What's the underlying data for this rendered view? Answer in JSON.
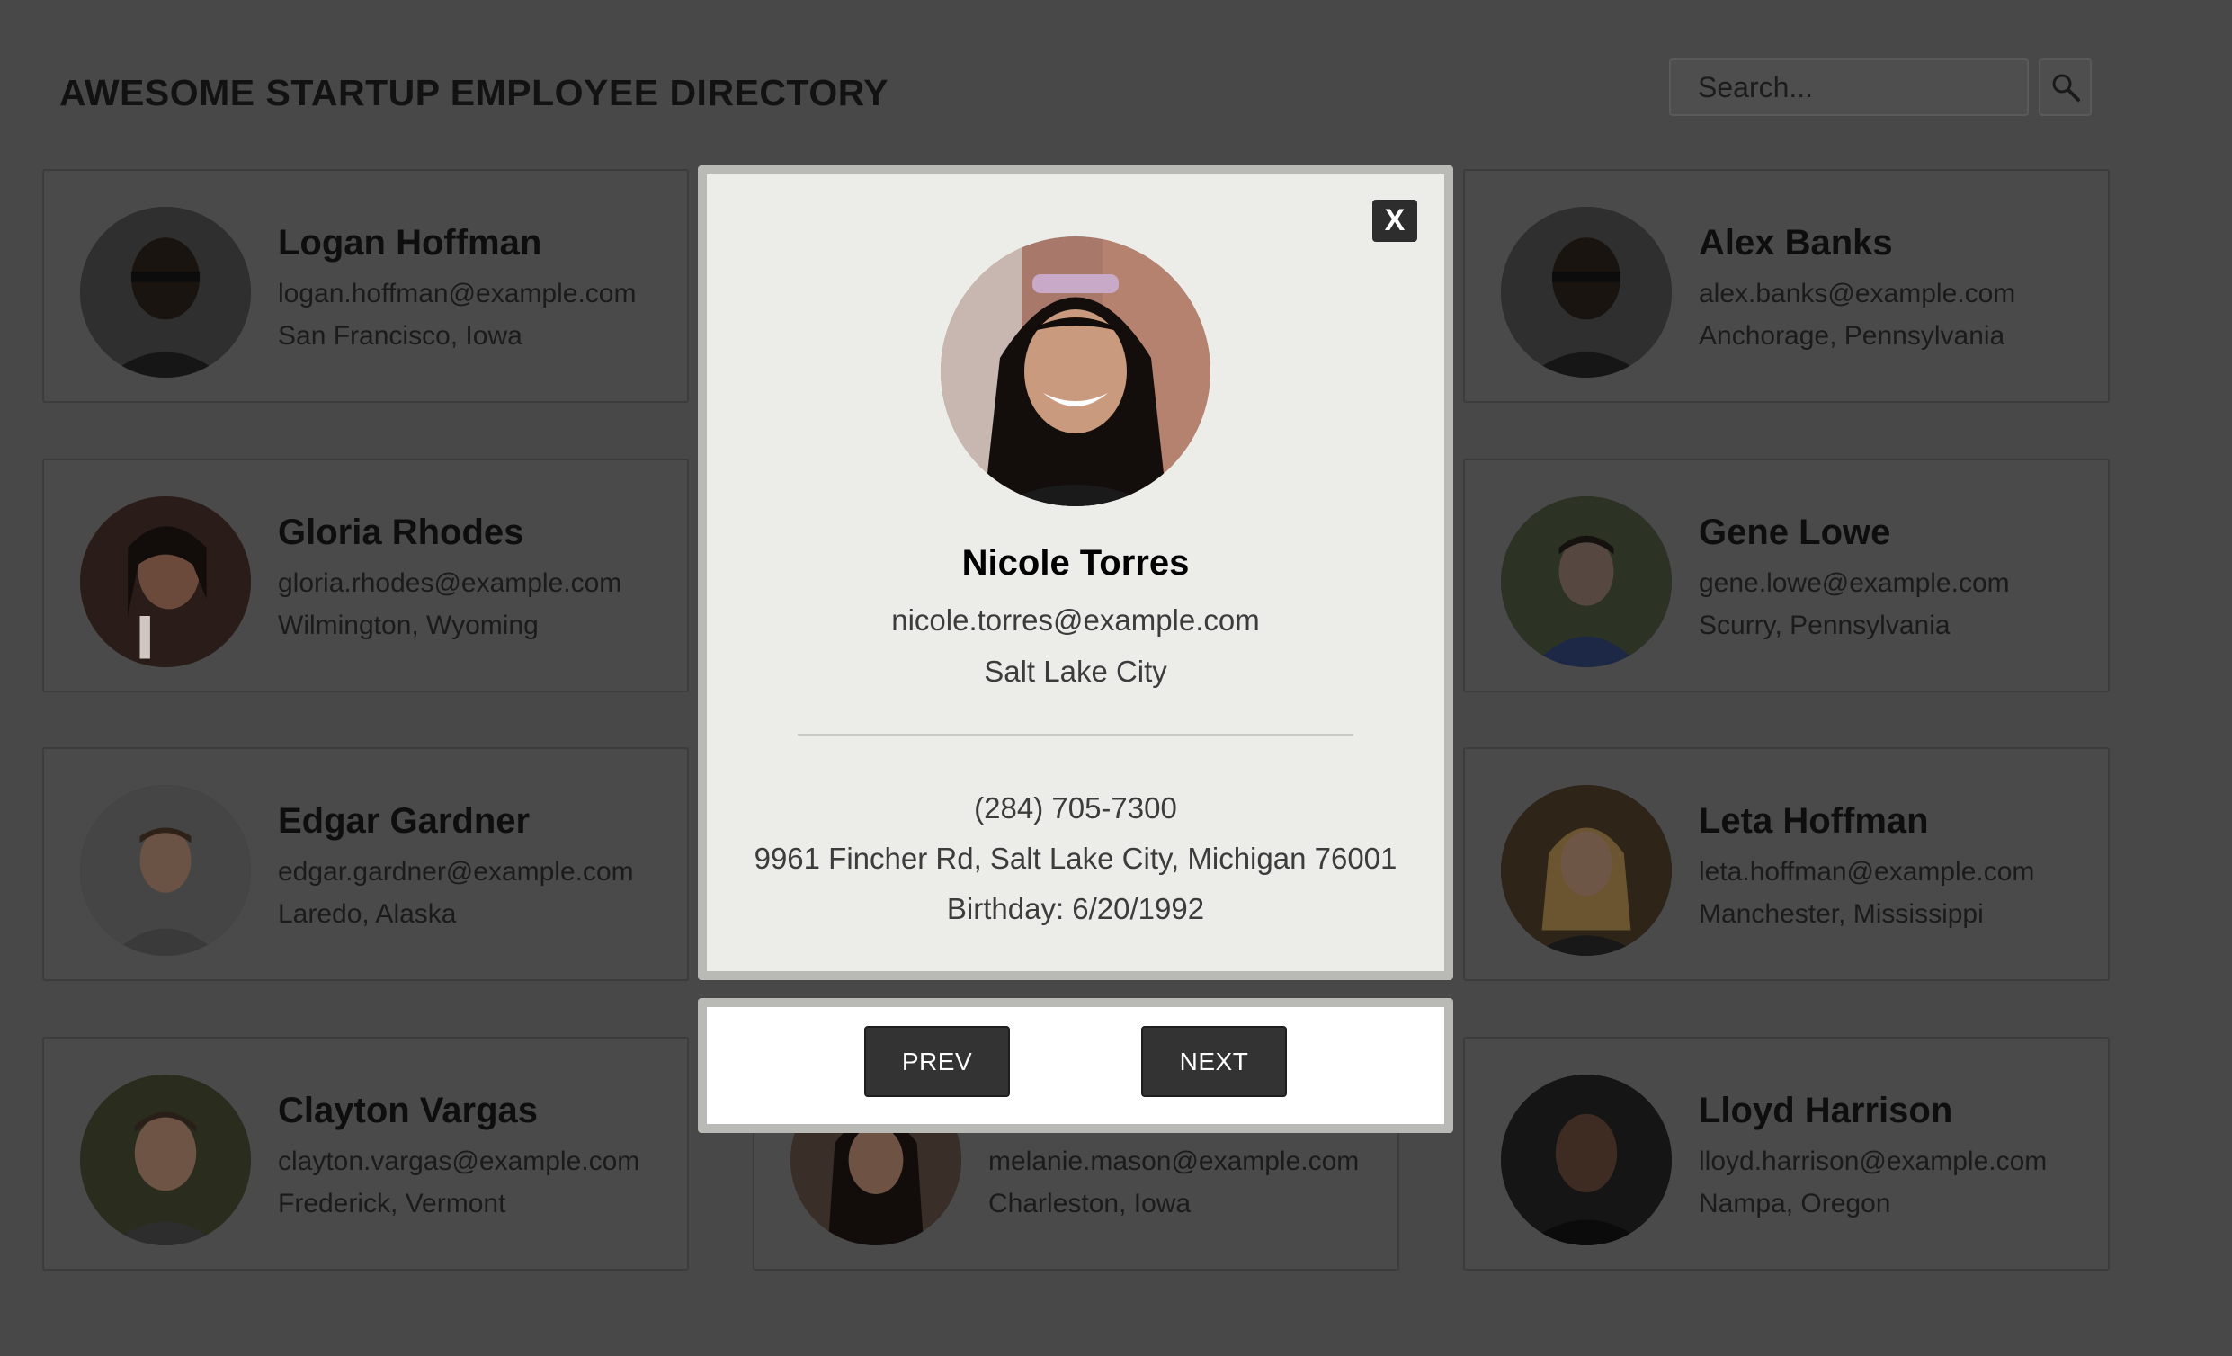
{
  "header": {
    "title": "AWESOME STARTUP EMPLOYEE DIRECTORY",
    "search_placeholder": "Search...",
    "search_icon": "magnifier-icon"
  },
  "employees": [
    {
      "name": "Logan Hoffman",
      "email": "logan.hoffman@example.com",
      "location": "San Francisco, Iowa"
    },
    {
      "name": "Alex Banks",
      "email": "alex.banks@example.com",
      "location": "Anchorage, Pennsylvania"
    },
    {
      "name": "Gloria Rhodes",
      "email": "gloria.rhodes@example.com",
      "location": "Wilmington, Wyoming"
    },
    {
      "name": "Gene Lowe",
      "email": "gene.lowe@example.com",
      "location": "Scurry, Pennsylvania"
    },
    {
      "name": "Edgar Gardner",
      "email": "edgar.gardner@example.com",
      "location": "Laredo, Alaska"
    },
    {
      "name": "Leta Hoffman",
      "email": "leta.hoffman@example.com",
      "location": "Manchester, Mississippi"
    },
    {
      "name": "Clayton Vargas",
      "email": "clayton.vargas@example.com",
      "location": "Frederick, Vermont"
    },
    {
      "name": "",
      "email": "melanie.mason@example.com",
      "location": "Charleston, Iowa"
    },
    {
      "name": "Lloyd Harrison",
      "email": "lloyd.harrison@example.com",
      "location": "Nampa, Oregon"
    }
  ],
  "modal": {
    "close_label": "X",
    "name": "Nicole Torres",
    "email": "nicole.torres@example.com",
    "city": "Salt Lake City",
    "phone": "(284) 705-7300",
    "address": "9961 Fincher Rd, Salt Lake City, Michigan 76001",
    "birthday": "Birthday: 6/20/1992",
    "prev_label": "PREV",
    "next_label": "NEXT"
  },
  "colors": {
    "overlay_bg": "#484848",
    "modal_bg": "#ecede9",
    "button_bg": "#333333"
  }
}
